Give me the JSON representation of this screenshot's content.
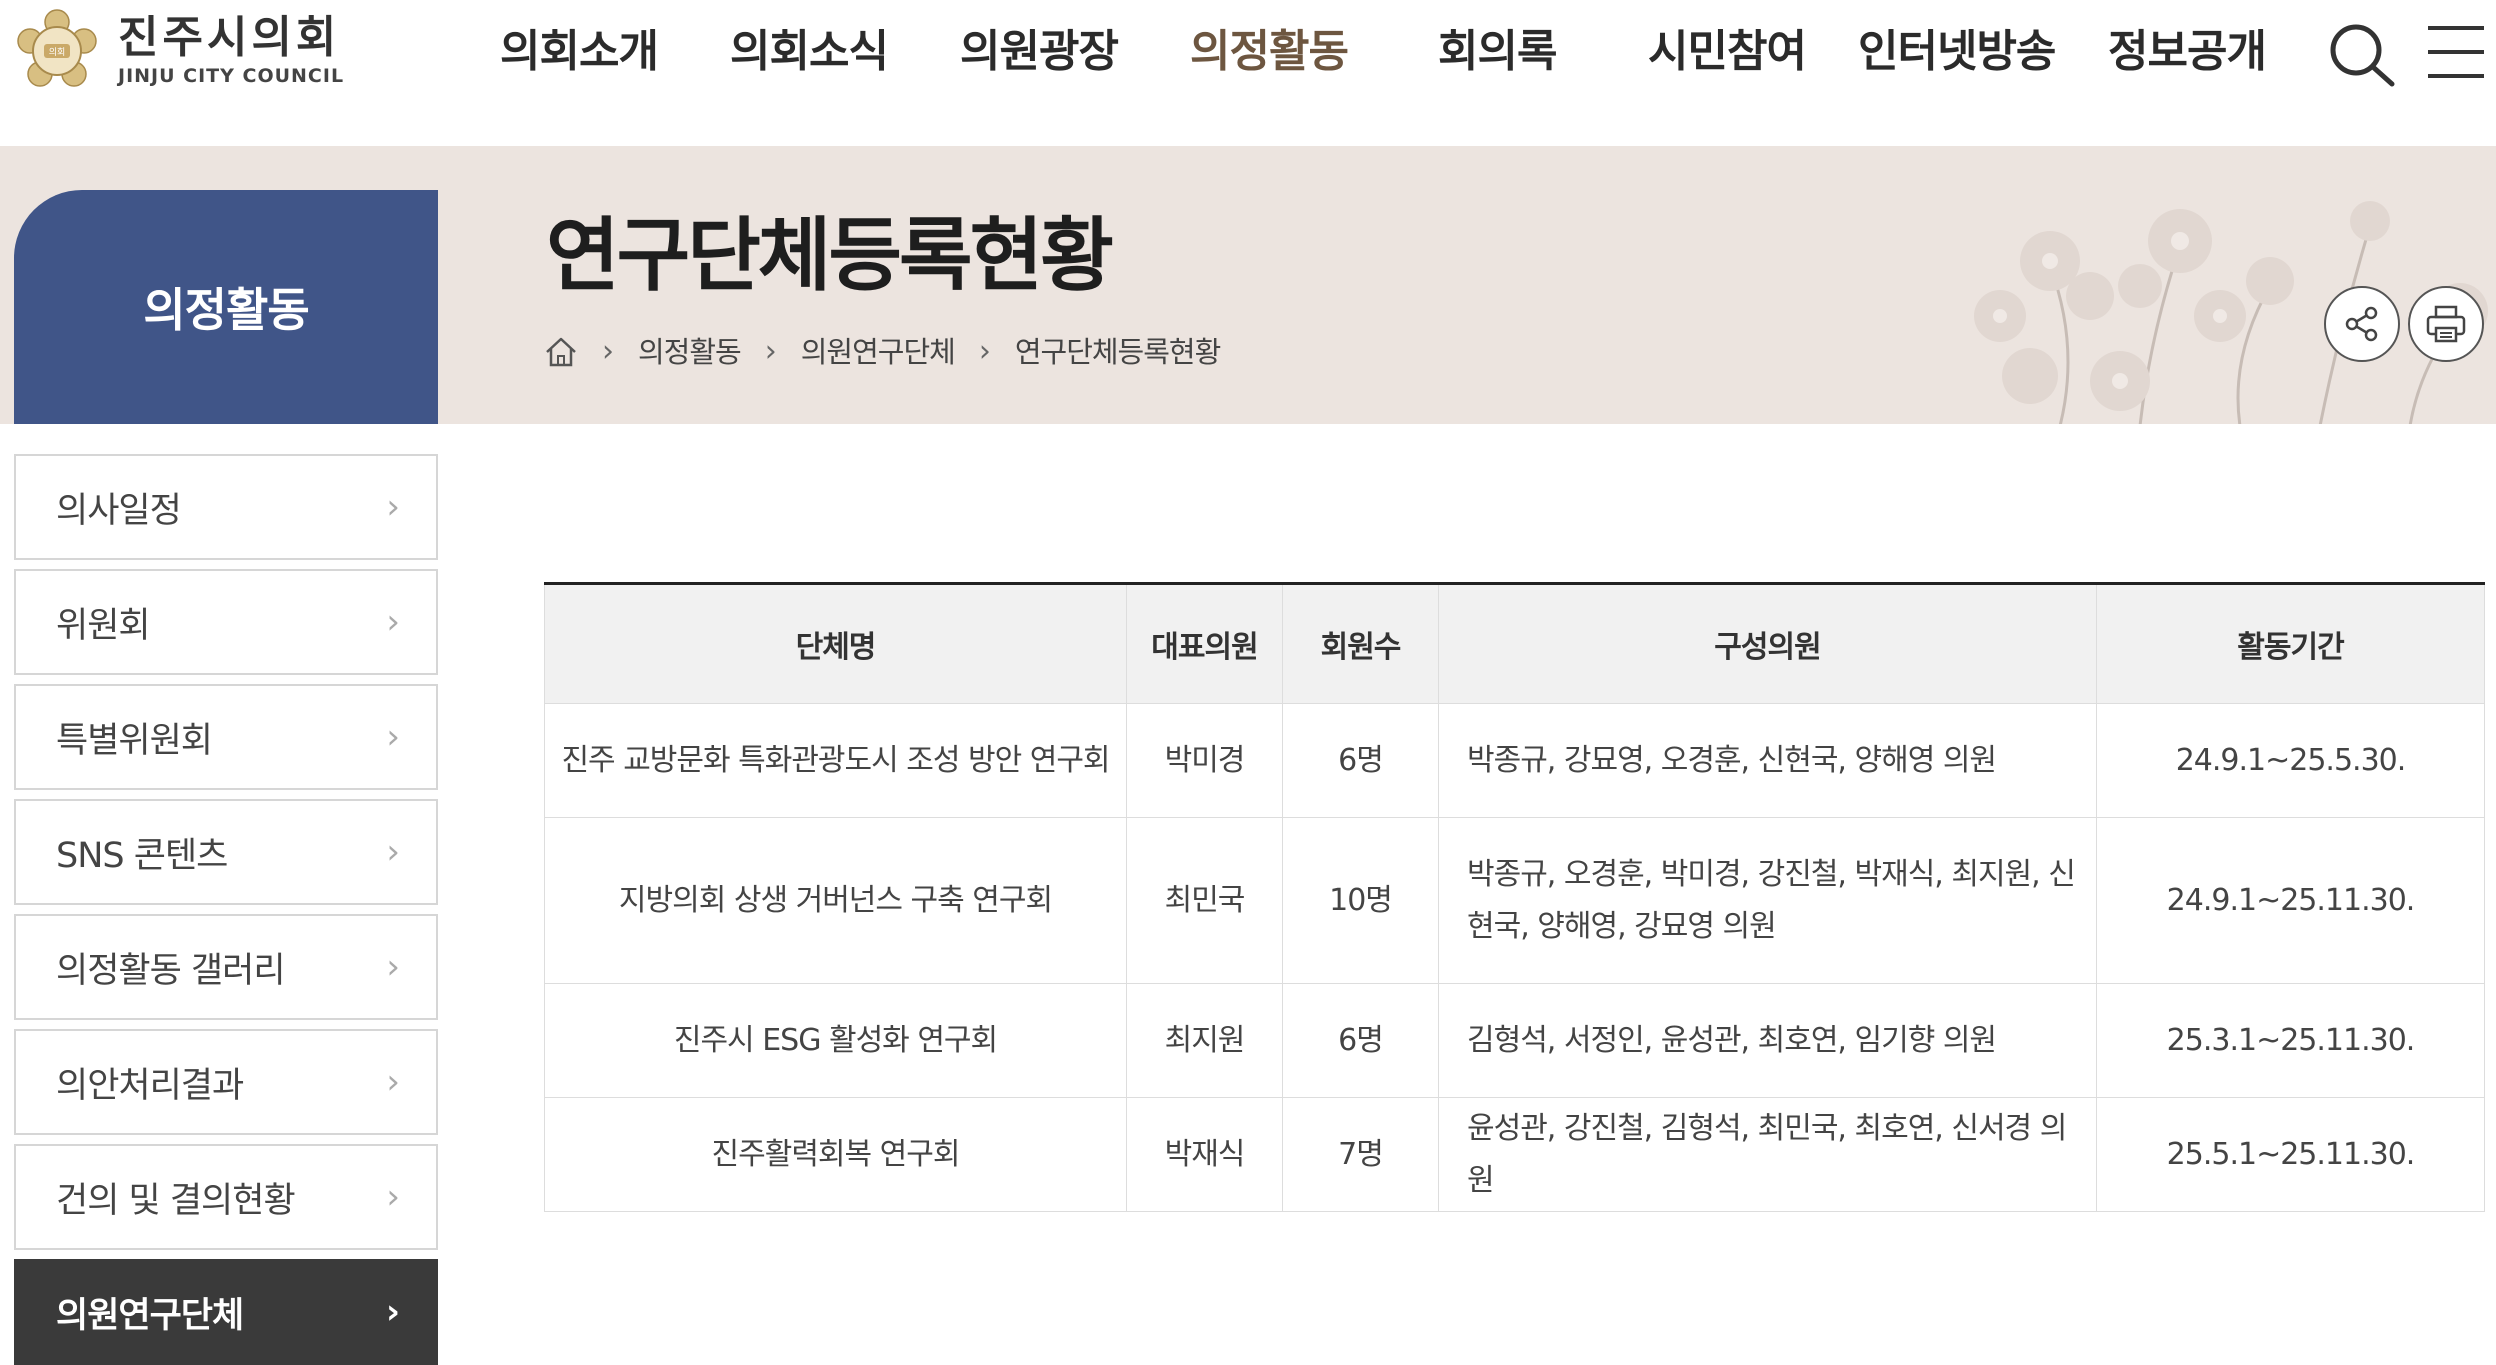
{
  "header": {
    "logo_title": "진주시의회",
    "logo_subtitle": "JINJU CITY COUNCIL",
    "nav": [
      {
        "label": "의회소개",
        "active": false
      },
      {
        "label": "의회소식",
        "active": false
      },
      {
        "label": "의원광장",
        "active": false
      },
      {
        "label": "의정활동",
        "active": true
      },
      {
        "label": "회의록",
        "active": false
      },
      {
        "label": "시민참여",
        "active": false
      },
      {
        "label": "인터넷방송",
        "active": false
      },
      {
        "label": "정보공개",
        "active": false
      }
    ],
    "icons": [
      "search-icon",
      "hamburger-menu-icon"
    ]
  },
  "banner": {
    "page_title": "연구단체등록현황",
    "breadcrumb": [
      "의정활동",
      "의원연구단체",
      "연구단체등록현황"
    ],
    "tools": [
      "share-icon",
      "print-icon"
    ]
  },
  "sidebar": {
    "title": "의정활동",
    "items": [
      {
        "label": "의사일정",
        "active": false
      },
      {
        "label": "위원회",
        "active": false
      },
      {
        "label": "특별위원회",
        "active": false
      },
      {
        "label": "SNS 콘텐츠",
        "active": false
      },
      {
        "label": "의정활동 갤러리",
        "active": false
      },
      {
        "label": "의안처리결과",
        "active": false
      },
      {
        "label": "건의 및 결의현황",
        "active": false
      },
      {
        "label": "의원연구단체",
        "active": true
      }
    ]
  },
  "table": {
    "headers": [
      "단체명",
      "대표의원",
      "회원수",
      "구성의원",
      "활동기간"
    ],
    "rows": [
      {
        "name": "진주 교방문화 특화관광도시 조성 방안 연구회",
        "leader": "박미경",
        "count": "6명",
        "members": "박종규, 강묘영, 오경훈, 신현국, 양해영 의원",
        "period": "24.9.1~25.5.30."
      },
      {
        "name": "지방의회 상생 거버넌스 구축 연구회",
        "leader": "최민국",
        "count": "10명",
        "members": "박종규, 오경훈, 박미경, 강진철, 박재식, 최지원, 신현국, 양해영, 강묘영 의원",
        "period": "24.9.1~25.11.30."
      },
      {
        "name": "진주시 ESG 활성화 연구회",
        "leader": "최지원",
        "count": "6명",
        "members": "김형석, 서정인, 윤성관, 최호연, 임기향 의원",
        "period": "25.3.1~25.11.30."
      },
      {
        "name": "진주활력회복 연구회",
        "leader": "박재식",
        "count": "7명",
        "members": "윤성관, 강진철, 김형석, 최민국, 최호연, 신서경 의원",
        "period": "25.5.1~25.11.30."
      }
    ]
  },
  "colors": {
    "sidebar_title_bg": "#405588",
    "banner_bg": "#ece4df",
    "active_nav": "#6d5640",
    "active_sidebar_bg": "#3a3a3a"
  }
}
